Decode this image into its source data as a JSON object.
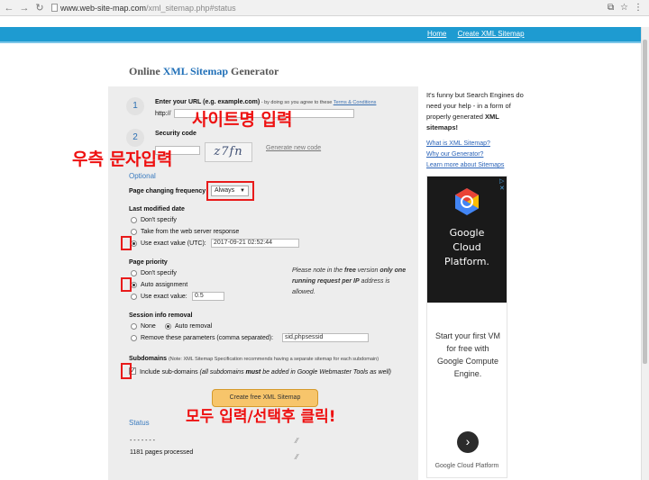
{
  "browser": {
    "url_host": "www.web-site-map.com",
    "url_path": "/xml_sitemap.php#status"
  },
  "header": {
    "links": [
      "Home",
      "Create XML Sitemap"
    ]
  },
  "site_title": {
    "prefix": "Online ",
    "highlight": "XML Sitemap",
    "suffix": " Generator"
  },
  "form": {
    "step1": {
      "num": "1",
      "title": "Enter your URL (e.g. example.com)",
      "note": " - by doing so you agree to these ",
      "terms_link": "Terms & Conditions",
      "url_prefix": "http://",
      "url_value": ""
    },
    "step2": {
      "num": "2",
      "title": "Security code",
      "captcha": "z7fn",
      "regen_link": "Generate new code"
    },
    "optional": "Optional",
    "page_freq": {
      "label": "Page changing frequency",
      "selected": "Always"
    },
    "last_modified": {
      "label": "Last modified date",
      "options": [
        "Don't specify",
        "Take from the web server response",
        "Use exact value (UTC):"
      ],
      "value": "2017-09-21 02:52:44"
    },
    "priority": {
      "label": "Page priority",
      "options": [
        "Don't specify",
        "Auto assignment",
        "Use exact value:"
      ],
      "value": "0.5"
    },
    "note": {
      "part1": "Please note in the ",
      "free": "free",
      "part2": " version ",
      "only": "only one running request per IP",
      "part3": " address is allowed."
    },
    "session": {
      "label": "Session info removal",
      "none": "None",
      "auto": "Auto removal",
      "remove": "Remove these parameters (comma separated):",
      "value": "sid,phpsessid"
    },
    "subdomains": {
      "label": "Subdomains",
      "small": "(Note: XML Sitemap Specification recommends having a separate sitemap for each subdomain)",
      "include_a": "Include sub-domains ",
      "include_b": "(all subdomains ",
      "must": "must",
      "include_c": " be added in Google Webmaster Tools as well)"
    },
    "create_button": "Create free XML Sitemap",
    "status_heading": "Status",
    "status_dots": "- - - - - - -",
    "status_pages": "1181 pages processed"
  },
  "annotations": {
    "site_name": "사이트명 입력",
    "captcha": "우측 문자입력",
    "click_all": "모두 입력/선택후  클릭!"
  },
  "sidebar": {
    "intro_a": "It's funny but Search Engines do need your help - in a form of properly generated ",
    "intro_b": "XML sitemaps!",
    "links": [
      "What is XML Sitemap?",
      "Why our Generator?",
      "Learn more about Sitemaps"
    ]
  },
  "ad": {
    "brand": "Google\nCloud\nPlatform.",
    "text": "Start your first VM for free with Google Compute Engine.",
    "foot": "Google Cloud Platform",
    "arrow": "›",
    "choices": "▷ ✕"
  },
  "colors": {
    "header_bar": "#1e9bd1",
    "annotation": "#ee1111",
    "button": "#f7c56b"
  }
}
